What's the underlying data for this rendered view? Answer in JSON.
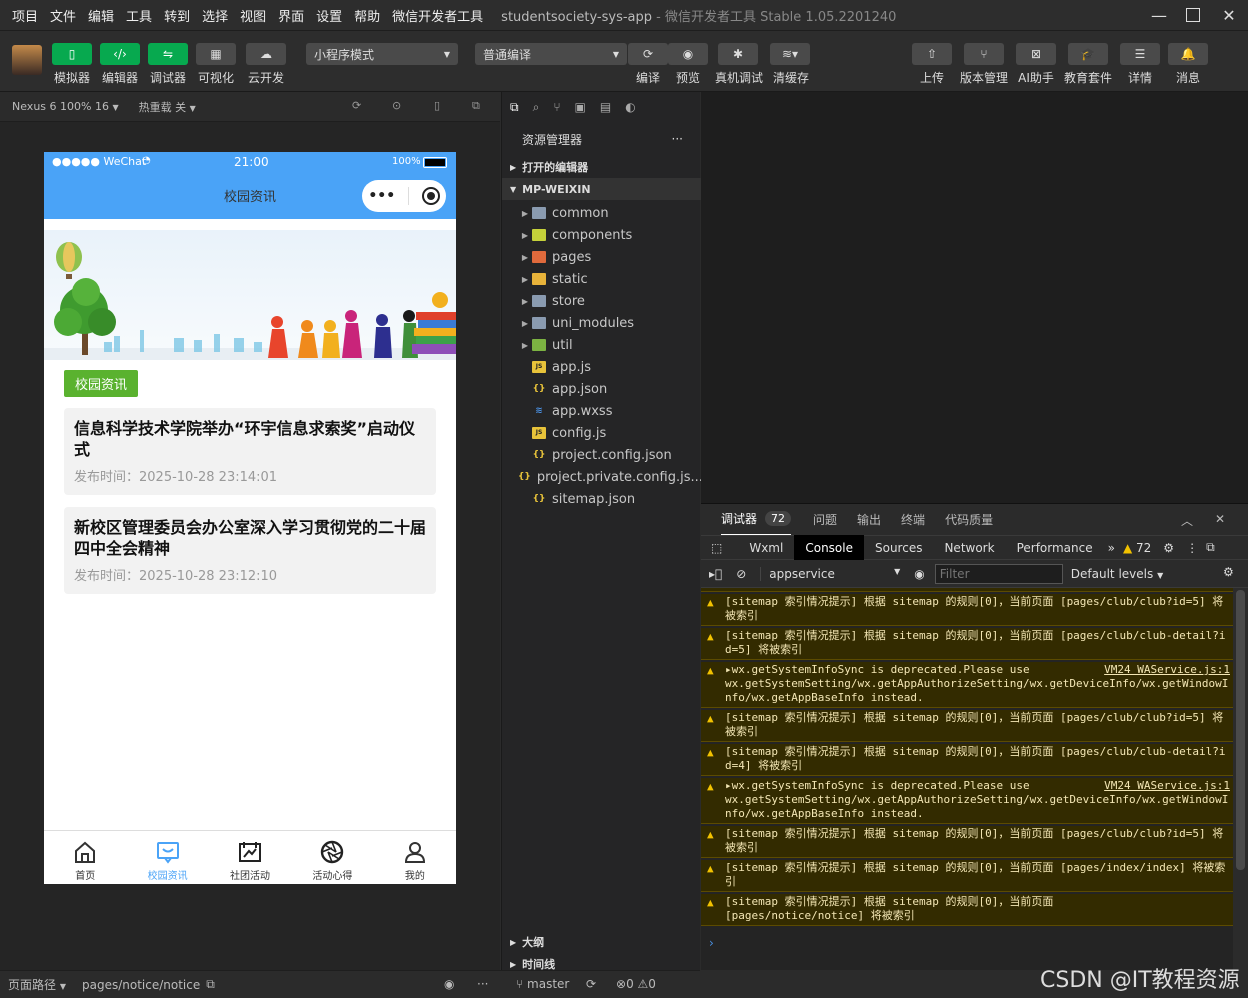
{
  "menubar": {
    "items": [
      "项目",
      "文件",
      "编辑",
      "工具",
      "转到",
      "选择",
      "视图",
      "界面",
      "设置",
      "帮助",
      "微信开发者工具"
    ],
    "project_title": "studentsociety-sys-app",
    "app_version": "- 微信开发者工具 Stable 1.05.2201240"
  },
  "toolbar": {
    "left_buttons": [
      "模拟器",
      "编辑器",
      "调试器",
      "可视化",
      "云开发"
    ],
    "mode_select": "小程序模式",
    "compile_select": "普通编译",
    "mid_buttons": [
      "编译",
      "预览",
      "真机调试",
      "清缓存"
    ],
    "right_buttons": [
      "上传",
      "版本管理",
      "AI助手",
      "教育套件",
      "详情",
      "消息"
    ]
  },
  "simulator_bar": {
    "device": "Nexus 6 100% 16",
    "hot_reload": "热重载 关"
  },
  "phone": {
    "status_signal": "●●●●● WeChat",
    "status_time": "21:00",
    "status_battery": "100%",
    "nav_title": "校园资讯",
    "capsule_more": "•••",
    "section_tag": "校园资讯",
    "news": [
      {
        "title": "信息科学技术学院举办“环宇信息求索奖”启动仪式",
        "meta": "发布时间：2025-10-28 23:14:01"
      },
      {
        "title": "新校区管理委员会办公室深入学习贯彻党的二十届四中全会精神",
        "meta": "发布时间：2025-10-28 23:12:10"
      }
    ],
    "tabs": [
      {
        "label": "首页",
        "icon": "home-icon"
      },
      {
        "label": "校园资讯",
        "icon": "news-icon"
      },
      {
        "label": "社团活动",
        "icon": "flag-icon"
      },
      {
        "label": "活动心得",
        "icon": "aperture-icon"
      },
      {
        "label": "我的",
        "icon": "user-icon"
      }
    ]
  },
  "bottom_bar": {
    "page_path_label": "页面路径",
    "page_path": "pages/notice/notice",
    "branch": "master",
    "errors": "0",
    "warnings": "0"
  },
  "explorer": {
    "header": "资源管理器",
    "more": "···",
    "open_editors": "打开的编辑器",
    "project": "MP-WEIXIN",
    "files": [
      {
        "name": "common",
        "type": "folder",
        "color": "#8a9bb0"
      },
      {
        "name": "components",
        "type": "folder",
        "color": "#c5d13a"
      },
      {
        "name": "pages",
        "type": "folder",
        "color": "#e06a3c"
      },
      {
        "name": "static",
        "type": "folder",
        "color": "#e8b33a"
      },
      {
        "name": "store",
        "type": "folder",
        "color": "#8a9bb0"
      },
      {
        "name": "uni_modules",
        "type": "folder",
        "color": "#8a9bb0"
      },
      {
        "name": "util",
        "type": "folder",
        "color": "#7cb342"
      },
      {
        "name": "app.js",
        "type": "js",
        "color": "#e8c33a"
      },
      {
        "name": "app.json",
        "type": "json",
        "color": "#e8c33a"
      },
      {
        "name": "app.wxss",
        "type": "css",
        "color": "#4a90e2"
      },
      {
        "name": "config.js",
        "type": "js",
        "color": "#e8c33a"
      },
      {
        "name": "project.config.json",
        "type": "json",
        "color": "#e8c33a"
      },
      {
        "name": "project.private.config.js...",
        "type": "json",
        "color": "#e8c33a"
      },
      {
        "name": "sitemap.json",
        "type": "json",
        "color": "#e8c33a"
      }
    ],
    "outline": "大纲",
    "timeline": "时间线"
  },
  "devtools": {
    "top_tabs": [
      "调试器",
      "问题",
      "输出",
      "终端",
      "代码质量"
    ],
    "debugger_count": "72",
    "panel_tabs": [
      "Wxml",
      "Console",
      "Sources",
      "Network",
      "Performance"
    ],
    "active_panel": "Console",
    "more_tabs": "»",
    "warning_count": "72",
    "context": "appservice",
    "filter_placeholder": "Filter",
    "levels": "Default levels",
    "logs": [
      {
        "text": "owInfo/wx.getAppBaseInfo instead.",
        "src": ""
      },
      {
        "text": "[sitemap 索引情况提示] 根据 sitemap 的规则[0]，当前页面 [pages/club/club?id=5] 将被索引",
        "src": ""
      },
      {
        "text": "[sitemap 索引情况提示] 根据 sitemap 的规则[0]，当前页面 [pages/club/club-detail?id=5] 将被索引",
        "src": ""
      },
      {
        "text": "▸wx.getSystemInfoSync is deprecated.Please use\nwx.getSystemSetting/wx.getAppAuthorizeSetting/wx.getDeviceInfo/wx.getWindowInfo/wx.getAppBaseInfo instead.",
        "src": "VM24 WAService.js:1"
      },
      {
        "text": "[sitemap 索引情况提示] 根据 sitemap 的规则[0]，当前页面 [pages/club/club?id=5] 将被索引",
        "src": ""
      },
      {
        "text": "[sitemap 索引情况提示] 根据 sitemap 的规则[0]，当前页面 [pages/club/club-detail?id=4] 将被索引",
        "src": ""
      },
      {
        "text": "▸wx.getSystemInfoSync is deprecated.Please use\nwx.getSystemSetting/wx.getAppAuthorizeSetting/wx.getDeviceInfo/wx.getWindowInfo/wx.getAppBaseInfo instead.",
        "src": "VM24 WAService.js:1"
      },
      {
        "text": "[sitemap 索引情况提示] 根据 sitemap 的规则[0]，当前页面 [pages/club/club?id=5] 将被索引",
        "src": ""
      },
      {
        "text": "[sitemap 索引情况提示] 根据 sitemap 的规则[0]，当前页面 [pages/index/index] 将被索引",
        "src": ""
      },
      {
        "text": "[sitemap 索引情况提示] 根据 sitemap 的规则[0]，当前页面\n[pages/notice/notice] 将被索引",
        "src": ""
      }
    ],
    "prompt": "›"
  },
  "watermark": "CSDN @IT教程资源",
  "colors": {
    "accent_green": "#07a94f",
    "nav_blue": "#4aa3f7",
    "tag_green": "#5ab22f",
    "warn_bg": "#332b00"
  }
}
